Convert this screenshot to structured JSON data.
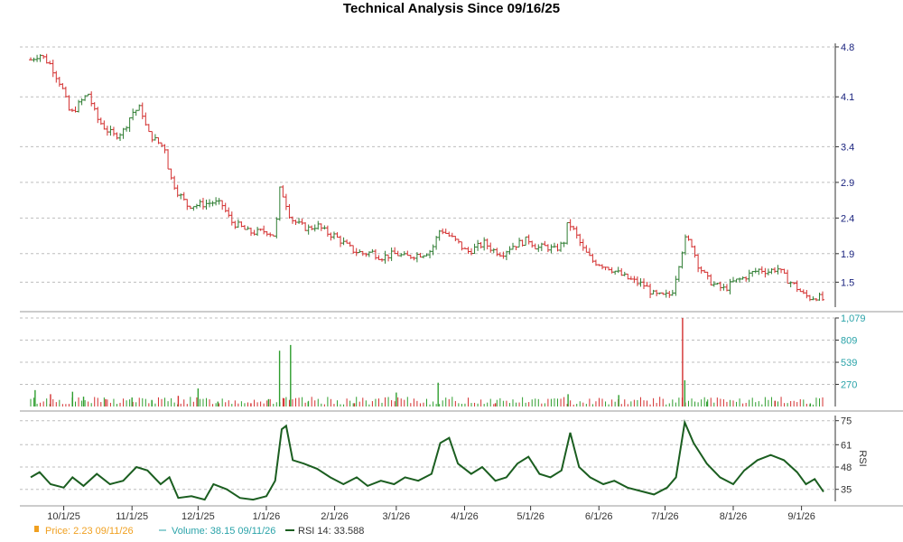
{
  "title": "Technical Analysis Since 09/16/25",
  "colors": {
    "up": "#2e7d32",
    "down": "#d32f2f",
    "volume": "#2e9e2e",
    "volume_down": "#d32f2f",
    "rsi": "#1b5e20",
    "price_legend": "#f0a020",
    "volume_legend": "#2aa3a9",
    "grid": "#bdbdbd"
  },
  "legend": {
    "price": "Price: 2.23",
    "price_date": "09/11/26",
    "volume": "Volume: 38.15",
    "volume_date": "09/11/26",
    "rsi": "RSI 14: 33.588"
  },
  "chart_data": [
    {
      "type": "line",
      "name": "price",
      "title": "Technical Analysis Since 09/16/25",
      "ylim": [
        1.15,
        4.85
      ],
      "y_ticks": [
        "4.8",
        "4.1",
        "3.4",
        "2.9",
        "2.4",
        "1.9",
        "1.5"
      ],
      "x_ticks": [
        "10/1/25",
        "11/1/25",
        "12/1/25",
        "1/1/26",
        "2/1/26",
        "3/1/26",
        "4/1/26",
        "5/1/26",
        "6/1/26",
        "7/1/26",
        "8/1/26",
        "9/1/26"
      ],
      "x_range": [
        "2025-09-16",
        "2026-09-11"
      ],
      "series": [
        {
          "values": [
            [
              "2025-09-16",
              4.62
            ],
            [
              "2025-09-20",
              4.7
            ],
            [
              "2025-09-25",
              4.55
            ],
            [
              "2025-09-30",
              4.25
            ],
            [
              "2025-10-04",
              3.85
            ],
            [
              "2025-10-08",
              4.0
            ],
            [
              "2025-10-12",
              4.15
            ],
            [
              "2025-10-16",
              3.8
            ],
            [
              "2025-10-20",
              3.65
            ],
            [
              "2025-10-24",
              3.55
            ],
            [
              "2025-10-28",
              3.62
            ],
            [
              "2025-11-01",
              3.88
            ],
            [
              "2025-11-05",
              3.95
            ],
            [
              "2025-11-08",
              3.6
            ],
            [
              "2025-11-12",
              3.48
            ],
            [
              "2025-11-16",
              3.38
            ],
            [
              "2025-11-18",
              3.0
            ],
            [
              "2025-11-22",
              2.75
            ],
            [
              "2025-11-26",
              2.58
            ],
            [
              "2025-11-30",
              2.58
            ],
            [
              "2025-12-04",
              2.6
            ],
            [
              "2025-12-08",
              2.62
            ],
            [
              "2025-12-12",
              2.58
            ],
            [
              "2025-12-16",
              2.35
            ],
            [
              "2025-12-20",
              2.28
            ],
            [
              "2025-12-24",
              2.2
            ],
            [
              "2025-12-28",
              2.2
            ],
            [
              "2026-01-01",
              2.22
            ],
            [
              "2026-01-05",
              2.15
            ],
            [
              "2026-01-07",
              2.8
            ],
            [
              "2026-01-09",
              2.7
            ],
            [
              "2026-01-12",
              2.4
            ],
            [
              "2026-01-16",
              2.3
            ],
            [
              "2026-01-20",
              2.25
            ],
            [
              "2026-01-24",
              2.3
            ],
            [
              "2026-01-28",
              2.2
            ],
            [
              "2026-02-01",
              2.15
            ],
            [
              "2026-02-05",
              2.05
            ],
            [
              "2026-02-09",
              1.95
            ],
            [
              "2026-02-14",
              1.9
            ],
            [
              "2026-02-18",
              1.92
            ],
            [
              "2026-02-22",
              1.85
            ],
            [
              "2026-02-26",
              1.88
            ],
            [
              "2026-03-01",
              1.9
            ],
            [
              "2026-03-05",
              1.85
            ],
            [
              "2026-03-09",
              1.88
            ],
            [
              "2026-03-13",
              1.9
            ],
            [
              "2026-03-17",
              1.95
            ],
            [
              "2026-03-21",
              2.25
            ],
            [
              "2026-03-25",
              2.15
            ],
            [
              "2026-03-29",
              2.05
            ],
            [
              "2026-04-02",
              1.92
            ],
            [
              "2026-04-06",
              1.98
            ],
            [
              "2026-04-10",
              2.05
            ],
            [
              "2026-04-14",
              1.95
            ],
            [
              "2026-04-18",
              1.9
            ],
            [
              "2026-04-22",
              2.0
            ],
            [
              "2026-04-26",
              2.05
            ],
            [
              "2026-04-30",
              2.1
            ],
            [
              "2026-05-04",
              1.98
            ],
            [
              "2026-05-08",
              2.0
            ],
            [
              "2026-05-12",
              1.95
            ],
            [
              "2026-05-16",
              2.05
            ],
            [
              "2026-05-18",
              2.35
            ],
            [
              "2026-05-21",
              2.2
            ],
            [
              "2026-05-25",
              1.95
            ],
            [
              "2026-05-29",
              1.8
            ],
            [
              "2026-06-02",
              1.75
            ],
            [
              "2026-06-06",
              1.7
            ],
            [
              "2026-06-10",
              1.62
            ],
            [
              "2026-06-14",
              1.55
            ],
            [
              "2026-06-18",
              1.5
            ],
            [
              "2026-06-22",
              1.45
            ],
            [
              "2026-06-26",
              1.32
            ],
            [
              "2026-06-30",
              1.3
            ],
            [
              "2026-07-04",
              1.33
            ],
            [
              "2026-07-08",
              1.85
            ],
            [
              "2026-07-10",
              2.1
            ],
            [
              "2026-07-13",
              2.05
            ],
            [
              "2026-07-16",
              1.75
            ],
            [
              "2026-07-20",
              1.55
            ],
            [
              "2026-07-24",
              1.45
            ],
            [
              "2026-07-28",
              1.4
            ],
            [
              "2026-08-01",
              1.5
            ],
            [
              "2026-08-05",
              1.55
            ],
            [
              "2026-08-09",
              1.62
            ],
            [
              "2026-08-13",
              1.68
            ],
            [
              "2026-08-17",
              1.65
            ],
            [
              "2026-08-21",
              1.7
            ],
            [
              "2026-08-25",
              1.55
            ],
            [
              "2026-08-29",
              1.45
            ],
            [
              "2026-09-02",
              1.32
            ],
            [
              "2026-09-05",
              1.28
            ],
            [
              "2026-09-08",
              1.3
            ],
            [
              "2026-09-11",
              1.25
            ]
          ]
        }
      ]
    },
    {
      "type": "bar",
      "name": "volume",
      "ylim": [
        0,
        1079
      ],
      "y_ticks": [
        "1,079",
        "809",
        "539",
        "270"
      ],
      "series": [
        {
          "values": [
            [
              "2025-09-18",
              200
            ],
            [
              "2025-09-25",
              150
            ],
            [
              "2025-10-05",
              180
            ],
            [
              "2025-10-10",
              120
            ],
            [
              "2025-10-20",
              90
            ],
            [
              "2025-11-01",
              110
            ],
            [
              "2025-11-10",
              80
            ],
            [
              "2025-11-22",
              130
            ],
            [
              "2025-12-01",
              220
            ],
            [
              "2025-12-10",
              60
            ],
            [
              "2025-12-25",
              40
            ],
            [
              "2026-01-02",
              90
            ],
            [
              "2026-01-07",
              680
            ],
            [
              "2026-01-09",
              100
            ],
            [
              "2026-01-12",
              750
            ],
            [
              "2026-01-20",
              60
            ],
            [
              "2026-02-10",
              40
            ],
            [
              "2026-03-01",
              170
            ],
            [
              "2026-03-20",
              290
            ],
            [
              "2026-04-15",
              40
            ],
            [
              "2026-05-18",
              150
            ],
            [
              "2026-06-10",
              140
            ],
            [
              "2026-07-09",
              1079
            ],
            [
              "2026-07-10",
              320
            ],
            [
              "2026-07-20",
              60
            ],
            [
              "2026-08-20",
              70
            ],
            [
              "2026-09-05",
              38
            ]
          ]
        }
      ]
    },
    {
      "type": "line",
      "name": "RSI 14",
      "ylabel": "RSI",
      "ylim": [
        28,
        78
      ],
      "y_ticks": [
        "75",
        "61",
        "48",
        "35"
      ],
      "series": [
        {
          "values": [
            [
              "2025-09-16",
              42
            ],
            [
              "2025-09-20",
              45
            ],
            [
              "2025-09-25",
              38
            ],
            [
              "2025-10-01",
              36
            ],
            [
              "2025-10-05",
              42
            ],
            [
              "2025-10-10",
              37
            ],
            [
              "2025-10-16",
              44
            ],
            [
              "2025-10-22",
              38
            ],
            [
              "2025-10-28",
              40
            ],
            [
              "2025-11-03",
              48
            ],
            [
              "2025-11-08",
              46
            ],
            [
              "2025-11-14",
              38
            ],
            [
              "2025-11-18",
              42
            ],
            [
              "2025-11-22",
              30
            ],
            [
              "2025-11-28",
              31
            ],
            [
              "2025-12-04",
              29
            ],
            [
              "2025-12-08",
              38
            ],
            [
              "2025-12-14",
              35
            ],
            [
              "2025-12-20",
              30
            ],
            [
              "2025-12-26",
              29
            ],
            [
              "2026-01-01",
              31
            ],
            [
              "2026-01-05",
              40
            ],
            [
              "2026-01-08",
              70
            ],
            [
              "2026-01-10",
              72
            ],
            [
              "2026-01-13",
              52
            ],
            [
              "2026-01-18",
              50
            ],
            [
              "2026-01-24",
              47
            ],
            [
              "2026-01-30",
              42
            ],
            [
              "2026-02-05",
              38
            ],
            [
              "2026-02-11",
              42
            ],
            [
              "2026-02-16",
              37
            ],
            [
              "2026-02-22",
              40
            ],
            [
              "2026-02-28",
              38
            ],
            [
              "2026-03-05",
              42
            ],
            [
              "2026-03-11",
              40
            ],
            [
              "2026-03-17",
              44
            ],
            [
              "2026-03-21",
              62
            ],
            [
              "2026-03-25",
              65
            ],
            [
              "2026-03-29",
              50
            ],
            [
              "2026-04-04",
              44
            ],
            [
              "2026-04-09",
              48
            ],
            [
              "2026-04-15",
              40
            ],
            [
              "2026-04-20",
              42
            ],
            [
              "2026-04-25",
              50
            ],
            [
              "2026-04-30",
              54
            ],
            [
              "2026-05-05",
              44
            ],
            [
              "2026-05-10",
              42
            ],
            [
              "2026-05-15",
              46
            ],
            [
              "2026-05-19",
              68
            ],
            [
              "2026-05-23",
              48
            ],
            [
              "2026-05-28",
              42
            ],
            [
              "2026-06-03",
              38
            ],
            [
              "2026-06-08",
              40
            ],
            [
              "2026-06-14",
              36
            ],
            [
              "2026-06-20",
              34
            ],
            [
              "2026-06-26",
              32
            ],
            [
              "2026-07-02",
              36
            ],
            [
              "2026-07-06",
              42
            ],
            [
              "2026-07-10",
              74
            ],
            [
              "2026-07-14",
              62
            ],
            [
              "2026-07-20",
              50
            ],
            [
              "2026-07-26",
              42
            ],
            [
              "2026-08-01",
              38
            ],
            [
              "2026-08-06",
              46
            ],
            [
              "2026-08-12",
              52
            ],
            [
              "2026-08-18",
              55
            ],
            [
              "2026-08-24",
              52
            ],
            [
              "2026-08-30",
              45
            ],
            [
              "2026-09-03",
              38
            ],
            [
              "2026-09-07",
              41
            ],
            [
              "2026-09-11",
              33.588
            ]
          ]
        }
      ]
    }
  ]
}
